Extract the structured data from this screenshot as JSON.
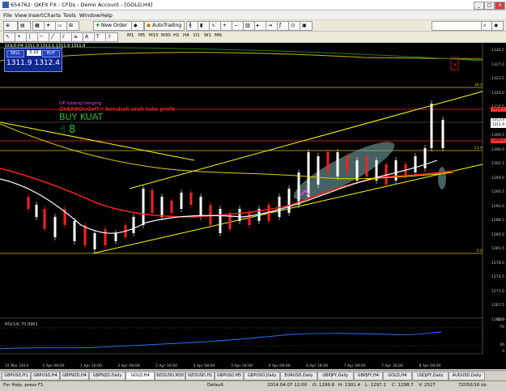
{
  "window": {
    "title": "654762: GKFX FX - CFDs - Demo Account - [GOLD,H4]"
  },
  "menu": [
    "File",
    "View",
    "Insert",
    "Charts",
    "Tools",
    "Window",
    "Help"
  ],
  "toolbar": {
    "new_order": "New Order",
    "autotrading": "AutoTrading",
    "timeframes": [
      "M1",
      "M5",
      "M15",
      "M30",
      "H1",
      "H4",
      "D1",
      "W1",
      "MN"
    ]
  },
  "chart": {
    "symbol_info": "GOLD,H4 1311.9 1312.1 1311.9 1311.9",
    "trade_panel": {
      "sell": "SELL",
      "buy": "BUY",
      "lot": "0.10",
      "bid": "1311.9",
      "ask": "1312.4"
    },
    "annotations": {
      "line1": "OP lubang hanging",
      "line2": "OVERBOUGHT!! berubah arah take profit",
      "line3": "BUY KUAT",
      "line4": "☝ 8"
    },
    "price_axis": [
      "1330.5",
      "1327.0",
      "1323.5",
      "1320.0",
      "1316.5",
      "1313.0",
      "1309.5",
      "1306.0",
      "1302.5",
      "1299.0",
      "1295.5",
      "1292.0",
      "1288.5",
      "1285.0",
      "1281.5",
      "1278.0",
      "1274.5",
      "1271.0",
      "1267.5",
      "1264.0"
    ],
    "price_boxes": [
      {
        "label": "1319.7",
        "color": "#ff3030"
      },
      {
        "label": "1312.4",
        "color": "#ffffff"
      },
      {
        "label": "1311.9",
        "color": "#ffffff"
      },
      {
        "label": "1308.3",
        "color": "#ff3030"
      }
    ],
    "fib_labels": [
      "38.2",
      "23.6",
      "0.0"
    ],
    "rsi_title": "RSI(14) 70.0961",
    "rsi_axis": [
      "100",
      "70",
      "30",
      "0"
    ],
    "time_axis": [
      "31 Mar 2014",
      "1 Apr 08:00",
      "1 Apr 16:00",
      "2 Apr 08:00",
      "2 Apr 16:00",
      "3 Apr 08:00",
      "3 Apr 16:00",
      "4 Apr 08:00",
      "4 Apr 16:00",
      "7 Apr 08:00",
      "7 Apr 16:00",
      "8 Apr 08:00"
    ]
  },
  "tabs": [
    {
      "label": "GBPUSD,H1",
      "active": false
    },
    {
      "label": "GBPUSD,H4",
      "active": false
    },
    {
      "label": "GBPNZD,H4",
      "active": false
    },
    {
      "label": "GBPNZD,Daily",
      "active": false
    },
    {
      "label": "GOLD,H4",
      "active": true
    },
    {
      "label": "NZDUSD,M30",
      "active": false
    },
    {
      "label": "NZDUSD,H1",
      "active": false
    },
    {
      "label": "GBPUSD,M5",
      "active": false
    },
    {
      "label": "GBPUSD,Daily",
      "active": false
    },
    {
      "label": "EURUSD,Daily",
      "active": false
    },
    {
      "label": "GBPJPY,Daily",
      "active": false
    },
    {
      "label": "GBPJPY,H4",
      "active": false
    },
    {
      "label": "GOLD,H4",
      "active": false
    },
    {
      "label": "USDJPY,Daily",
      "active": false
    },
    {
      "label": "AUDUSD,Daily",
      "active": false
    }
  ],
  "status": {
    "help": "For Help, press F1",
    "profile": "Default",
    "time": "2014.04.07 12:00",
    "open": "O: 1299.8",
    "high": "H: 1301.4",
    "low": "L: 1297.1",
    "close": "C: 1298.7",
    "volume": "V: 2527",
    "traffic": "72050/16 kb"
  },
  "colors": {
    "bull_candle": "#ffffff",
    "bear_candle": "#ff2020",
    "ma_white": "#ffffff",
    "ma_red": "#ff2020",
    "ma_yellow": "#e0d000",
    "trend_line": "#ffff00",
    "rsi_line": "#3070ff",
    "ellipse": "#7fb0b0"
  }
}
